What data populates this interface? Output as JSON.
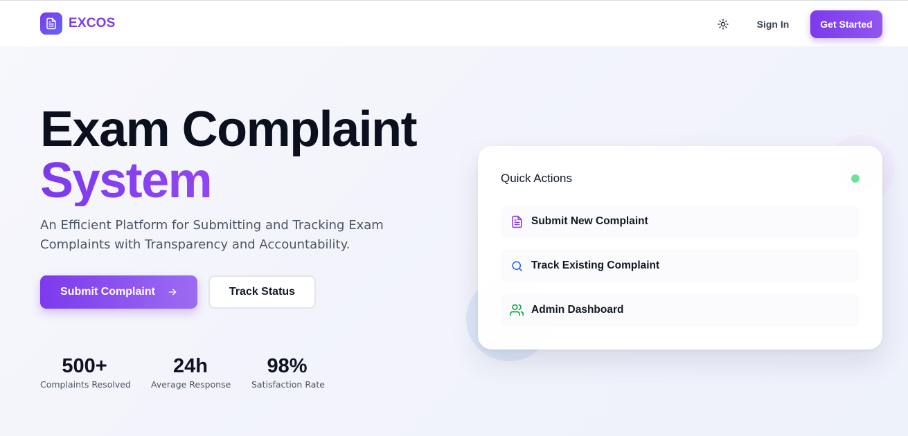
{
  "navbar": {
    "brand_name": "EXCOS",
    "sign_in_label": "Sign In",
    "get_started_label": "Get Started"
  },
  "hero": {
    "title_line1": "Exam Complaint",
    "title_line2": "System",
    "subtitle": "An Efficient Platform for Submitting and Tracking Exam Complaints with Transparency and Accountability.",
    "primary_button_label": "Submit Complaint",
    "secondary_button_label": "Track Status"
  },
  "stats": [
    {
      "value": "500+",
      "label": "Complaints Resolved"
    },
    {
      "value": "24h",
      "label": "Average Response"
    },
    {
      "value": "98%",
      "label": "Satisfaction Rate"
    }
  ],
  "quick_actions": {
    "title": "Quick Actions",
    "status_color": "#6ee29a",
    "items": [
      {
        "label": "Submit New Complaint",
        "icon": "document-icon",
        "color": "#8b3fd9"
      },
      {
        "label": "Track Existing Complaint",
        "icon": "search-icon",
        "color": "#2563eb"
      },
      {
        "label": "Admin Dashboard",
        "icon": "users-icon",
        "color": "#16a34a"
      }
    ]
  },
  "colors": {
    "accent": "#7c3aed",
    "accent_light": "#a855f7"
  }
}
